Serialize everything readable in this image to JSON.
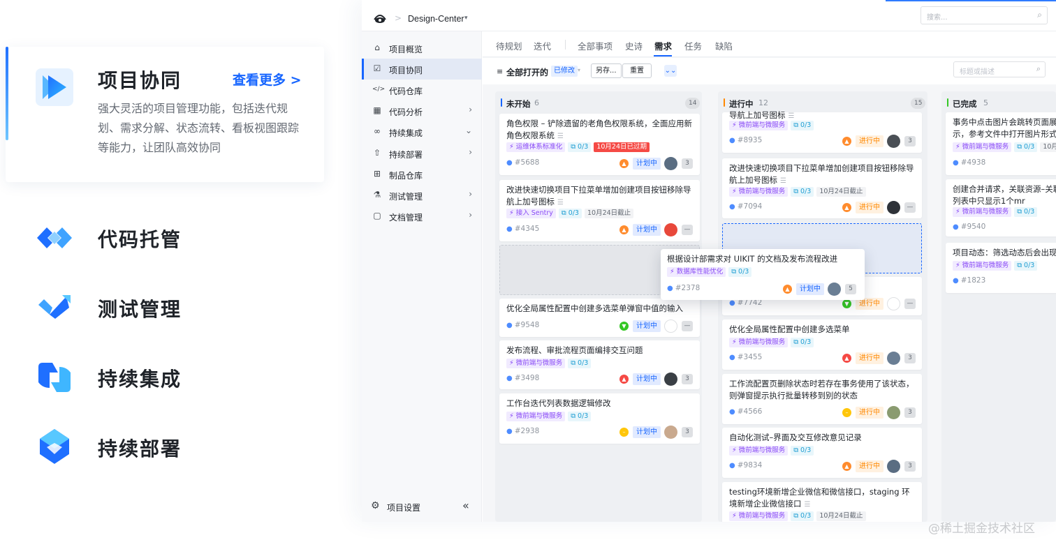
{
  "features": [
    {
      "title": "项目协同",
      "more": "查看更多 >",
      "desc": "强大灵活的项目管理功能，包括迭代规划、需求分解、状态流转、看板视图跟踪等能力，让团队高效协同"
    },
    {
      "title": "代码托管"
    },
    {
      "title": "测试管理"
    },
    {
      "title": "持续集成"
    },
    {
      "title": "持续部署"
    }
  ],
  "header": {
    "project": "Design-Center",
    "sep": ">",
    "caret": "▾",
    "search_placeholder": "搜索..."
  },
  "sidebar": {
    "items": [
      {
        "label": "项目概览",
        "icon": "⌂"
      },
      {
        "label": "项目协同",
        "icon": "☑"
      },
      {
        "label": "代码仓库",
        "icon": "</>"
      },
      {
        "label": "代码分析",
        "icon": "▦",
        "chevron": "›"
      },
      {
        "label": "持续集成",
        "icon": "∞",
        "chevron": "⌄"
      },
      {
        "label": "持续部署",
        "icon": "⇧",
        "chevron": "›"
      },
      {
        "label": "制品仓库",
        "icon": "⊞"
      },
      {
        "label": "测试管理",
        "icon": "⚗",
        "chevron": "›"
      },
      {
        "label": "文档管理",
        "icon": "▢",
        "chevron": "›"
      }
    ],
    "settings": "项目设置",
    "settings_icon": "⚙",
    "collapse_icon": "«"
  },
  "tabs": [
    "待规划",
    "迭代",
    "全部事项",
    "史诗",
    "需求",
    "任务",
    "缺陷"
  ],
  "filter": {
    "icon": "≡",
    "label": "全部打开的",
    "modified": "已修改",
    "caret": "▾",
    "save_as": "另存...",
    "reset": "重置",
    "expand": "⌄⌄",
    "search_placeholder": "标题或描述",
    "search_icon": "⌕"
  },
  "columns": [
    {
      "title": "未开始",
      "count": "6",
      "total": "14"
    },
    {
      "title": "进行中",
      "count": "12",
      "total": "15"
    },
    {
      "title": "已完成",
      "count": "5"
    }
  ],
  "col1_cards": [
    {
      "title": "角色权限 – 铲除遗留的老角色权限系统，全面应用新角色权限系统",
      "tag": "运维体系标准化",
      "sub": "0/3",
      "badge": "10月24日已过期",
      "id": "#5688",
      "status": "计划中",
      "cnt": "3"
    },
    {
      "title": "改进快速切换项目下拉菜单增加创建项目按钮移除导航上加号图标",
      "tag": "接入 Sentry",
      "sub": "0/3",
      "badge": "10月24日截止",
      "id": "#4345",
      "status": "计划中",
      "cnt": "—"
    },
    {
      "title": "优化全局属性配置中创建多选菜单弹窗中值的输入",
      "id": "#9548",
      "status": "计划中",
      "cnt": "—"
    },
    {
      "title": "发布流程、审批流程页面编排交互问题",
      "tag": "微前端与微服务",
      "sub": "0/3",
      "id": "#3498",
      "status": "计划中",
      "cnt": "3"
    },
    {
      "title": "工作台迭代列表数据逻辑修改",
      "tag": "微前端与微服务",
      "sub": "0/3",
      "id": "#2938",
      "status": "计划中",
      "cnt": "3"
    }
  ],
  "col2_cards": [
    {
      "title": "导航上加号图标",
      "tag": "微前端与微服务",
      "sub": "0/3",
      "id": "#8935",
      "status": "进行中",
      "cnt": "3"
    },
    {
      "title": "改进快速切换项目下拉菜单增加创建项目按钮移除导航上加号图标",
      "tag": "微前端与微服务",
      "sub": "0/3",
      "badge": "10月24日截止",
      "id": "#7094",
      "status": "进行中",
      "cnt": "—"
    },
    {
      "id": "#7742",
      "status": "进行中",
      "cnt": "—"
    },
    {
      "title": "优化全局属性配置中创建多选菜单",
      "tag": "微前端与微服务",
      "sub": "0/3",
      "id": "#3455",
      "status": "进行中",
      "cnt": "3"
    },
    {
      "title": "工作流配置页删除状态时若存在事务使用了该状态，则弹窗提示执行批量转移到别的状态",
      "id": "#4566",
      "status": "进行中",
      "cnt": "3"
    },
    {
      "title": "自动化测试–界面及交互修改意见记录",
      "tag": "微前端与微服务",
      "sub": "0/3",
      "id": "#9834",
      "status": "进行中",
      "cnt": "3"
    },
    {
      "title": "testing环境新增企业微信和微信接口，staging 环境新增企业微信接口",
      "tag": "微前端与微服务",
      "sub": "0/3",
      "badge": "10月24日截止"
    }
  ],
  "col3_cards": [
    {
      "title": "事务中点击图片会跳转页面展示，参考文件中打开图片形式",
      "tag": "微前端与微服务",
      "sub": "0/3",
      "badge": "10月",
      "id": "#4938"
    },
    {
      "title": "创建合并请求，关联资源–关联列表中只显示1个mr",
      "tag": "微前端与微服务",
      "sub": "0/3",
      "id": "#9540"
    },
    {
      "title": "项目动态：筛选动态后会出现",
      "tag": "微前端与微服务",
      "sub": "0/3",
      "id": "#1823"
    }
  ],
  "drag_card": {
    "title": "根据设计部需求对 UIKIT 的文档及发布流程改进",
    "tag": "数据库性能优化",
    "sub": "0/3",
    "id": "#2378",
    "status": "计划中",
    "cnt": "5"
  },
  "watermark": "@稀土掘金技术社区",
  "colors": {
    "accent": "#1665ff",
    "purple": "#8a4cf6",
    "orange": "#ff8800",
    "red": "#f54a45"
  }
}
